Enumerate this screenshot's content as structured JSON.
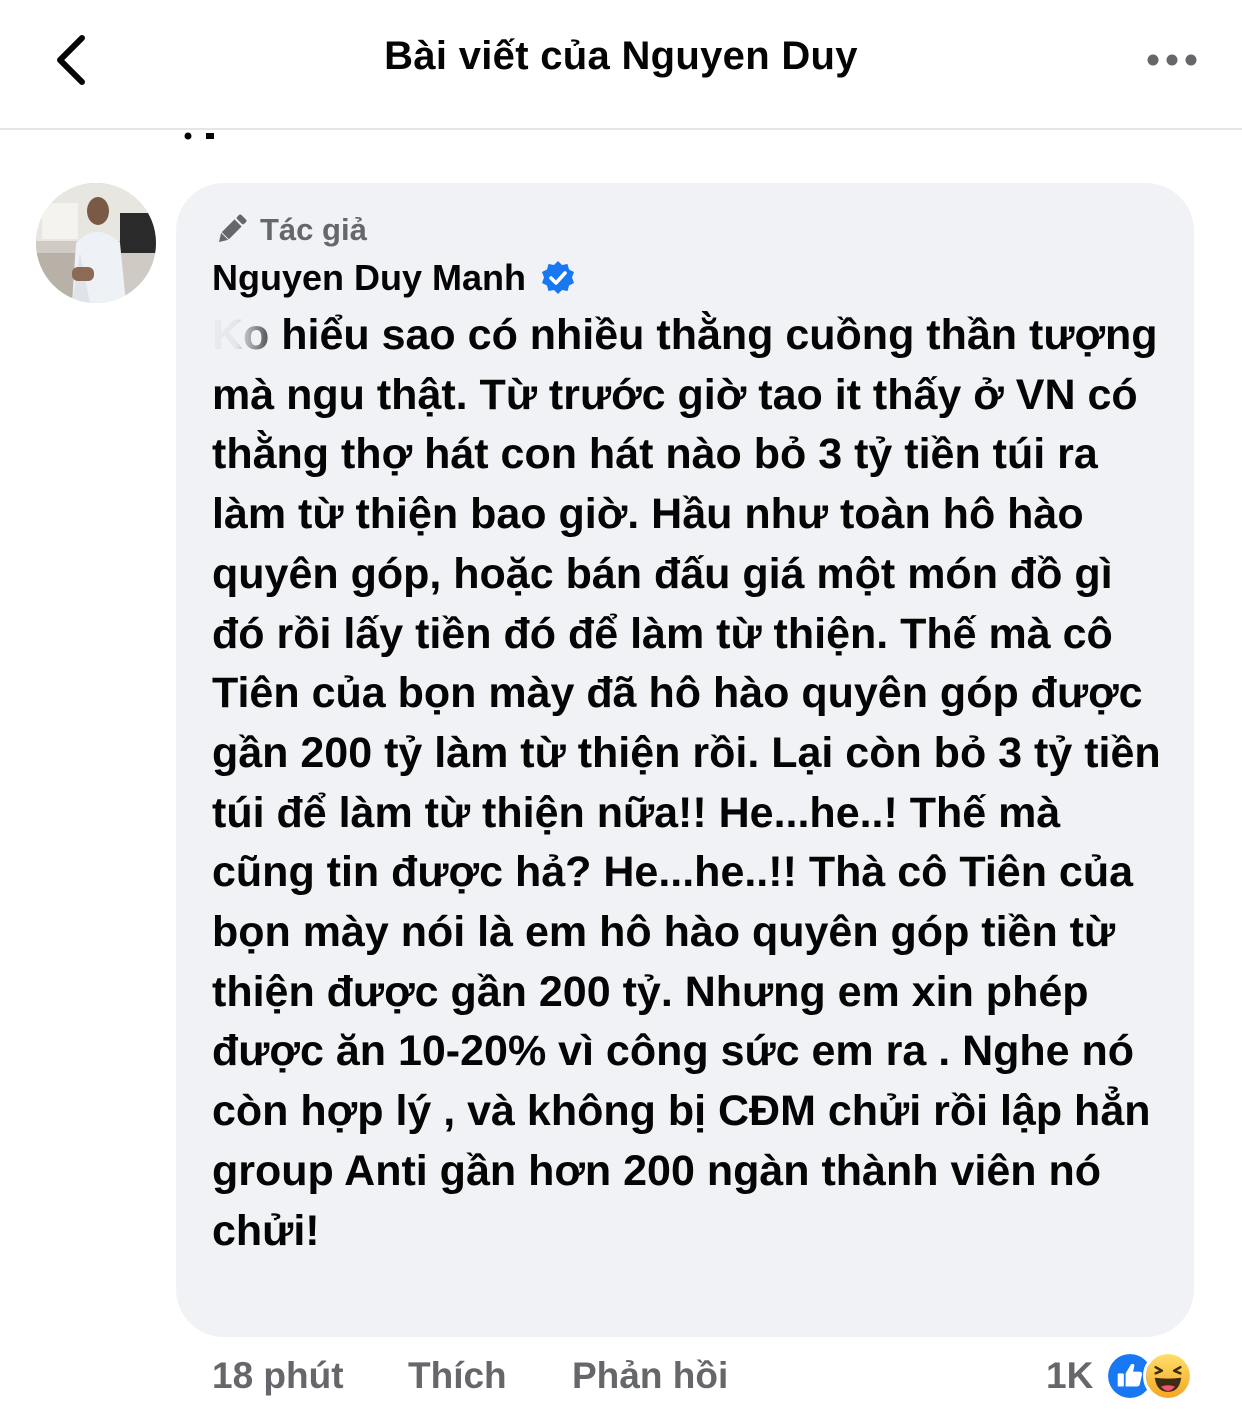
{
  "header": {
    "title": "Bài viết của Nguyen Duy"
  },
  "comment": {
    "badge_label": "Tác giả",
    "author_name": "Nguyen Duy Manh",
    "text": "Ko hiểu sao có nhiều thằng cuồng thần tượng mà ngu thật. Từ trước giờ tao it thấy ở VN có thằng thợ hát con hát nào bỏ 3 tỷ tiền túi ra làm từ thiện bao giờ. Hầu như toàn hô hào quyên góp, hoặc bán đấu giá một món đồ gì đó rồi lấy tiền đó để làm từ thiện. Thế mà cô Tiên của bọn mày đã hô hào quyên góp được gần 200 tỷ làm từ thiện rồi. Lại còn bỏ 3 tỷ tiền túi để làm từ thiện nữa!! He...he..! Thế mà cũng tin được hả? He...he..!! Thà cô Tiên của bọn mày nói là em hô hào quyên góp tiền từ thiện được gần 200 tỷ. Nhưng em xin phép được ăn 10-20% vì công sức em ra . Nghe nó còn hợp lý , và không bị CĐM chửi rồi lập hẳn group Anti gần hơn 200 ngàn thành viên nó chửi!",
    "time": "18 phút",
    "like_label": "Thích",
    "reply_label": "Phản hồi",
    "reaction_count": "1K"
  },
  "colors": {
    "secondary_text": "#65676b",
    "bubble_bg": "#f0f2f5",
    "verified_blue": "#1877f2",
    "like_blue": "#1877f2",
    "haha_yellow": "#f7b125"
  },
  "icons": {
    "back": "chevron-left-icon",
    "more": "more-dots-icon",
    "badge": "pencil-icon",
    "verified": "verified-check-icon",
    "like": "like-thumb-icon",
    "haha": "haha-face-icon"
  }
}
